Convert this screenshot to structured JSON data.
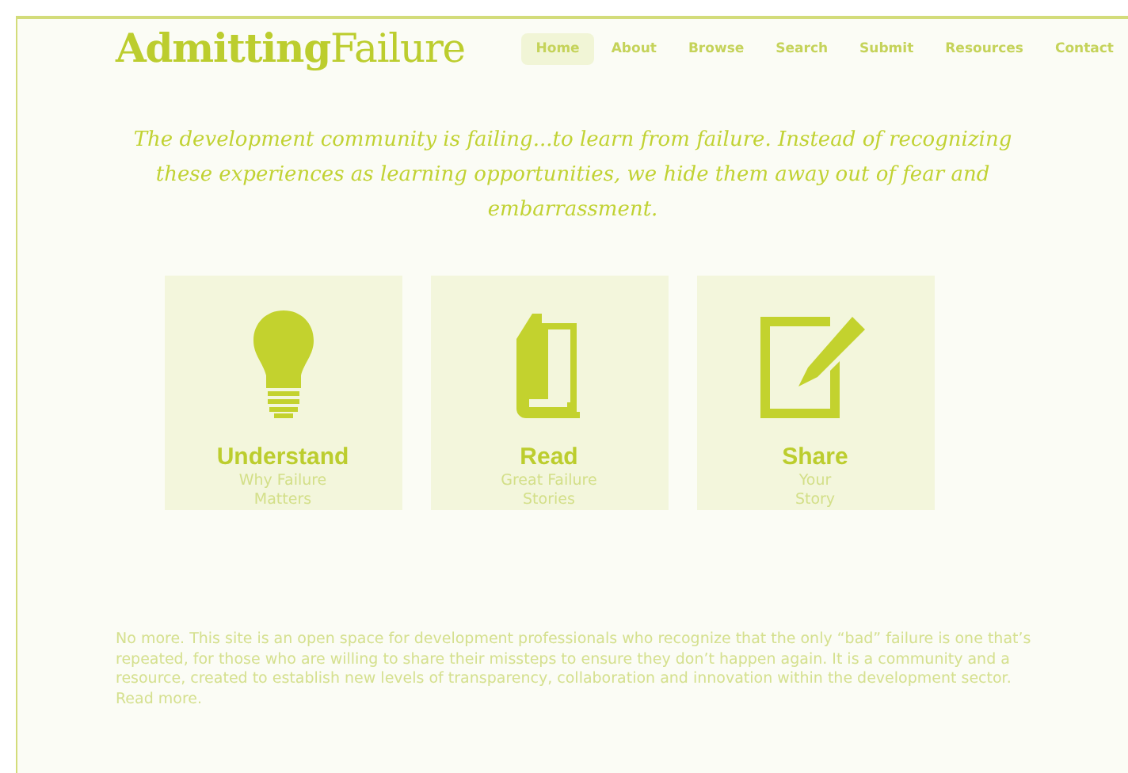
{
  "logo": {
    "bold": "Admitting",
    "light": "Failure"
  },
  "nav": [
    {
      "label": "Home",
      "selected": true
    },
    {
      "label": "About",
      "selected": false
    },
    {
      "label": "Browse",
      "selected": false
    },
    {
      "label": "Search",
      "selected": false
    },
    {
      "label": "Submit",
      "selected": false
    },
    {
      "label": "Resources",
      "selected": false
    },
    {
      "label": "Contact",
      "selected": false
    }
  ],
  "tagline": "The development community is failing...to learn from failure. Instead of recognizing these experiences as learning opportunities, we hide them away out of fear and embarrassment.",
  "cards": [
    {
      "kind": "bulb",
      "title": "Understand",
      "subtitle": [
        "Why Failure",
        "Matters"
      ]
    },
    {
      "kind": "book",
      "title": "Read",
      "subtitle": [
        "Great Failure",
        "Stories"
      ]
    },
    {
      "kind": "edit",
      "title": "Share",
      "subtitle": [
        "Your",
        "Story"
      ]
    }
  ],
  "body": {
    "text": "No more. This site is an open space for development professionals who recognize that the only “bad” failure is one that’s repeated, for those who are willing to share their missteps to ensure they don’t happen again. It is a community and a resource, created to establish new levels of transparency, collaboration and innovation within the development sector.",
    "link": "Read more."
  }
}
